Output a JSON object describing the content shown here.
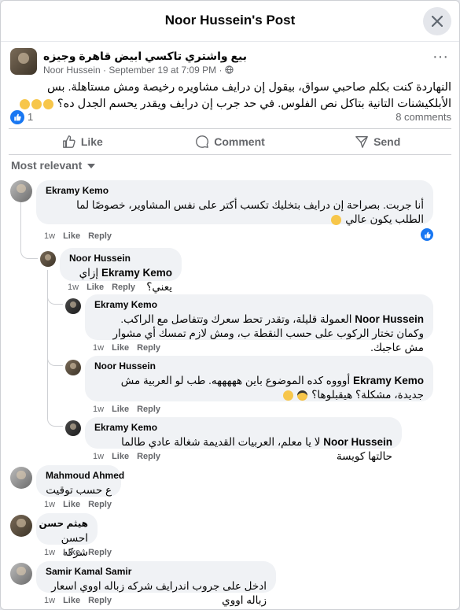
{
  "header": {
    "title": "Noor Hussein's Post"
  },
  "post": {
    "group_name": "بيع واشتري تاكسي ابيض قاهرة وجيزه",
    "author": "Noor Hussein",
    "separator": "·",
    "time": "September 19 at 7:09 PM",
    "audience_icon": "globe-icon",
    "text": "النهاردة كنت بكلم صاحبي سواق، بيقول إن درايف مشاويره رخيصة ومش مستاهلة. بس الأبلكيشنات التانية بتاكل نص الفلوس. في حد جرب إن درايف ويقدر يحسم الجدل ده؟",
    "emojis": [
      "slightly-smiling-face",
      "slightly-smiling-face",
      "slightly-smiling-face"
    ],
    "reaction_count": "1",
    "comment_count": "8 comments"
  },
  "actions": {
    "like": "Like",
    "comment": "Comment",
    "send": "Send"
  },
  "sort": {
    "label": "Most relevant"
  },
  "labels": {
    "time": "1w",
    "like": "Like",
    "reply": "Reply"
  },
  "comments": [
    {
      "name": "Ekramy Kemo",
      "text": "أنا جربت. بصراحة إن درايف بتخليك تكسب أكتر على نفس المشاوير، خصوصًا لما الطلب يكون عالي",
      "reacted": true
    },
    {
      "name": "Noor Hussein",
      "mention": "Ekramy Kemo",
      "text": "إزاي يعني؟"
    },
    {
      "name": "Ekramy Kemo",
      "mention": "Noor Hussein",
      "text": "العمولة قليلة، وتقدر تحط سعرك وتتفاصل مع الراكب. وكمان تختار الركوب على حسب النقطة ب، ومش لازم تمسك أي مشوار مش عاجبك."
    },
    {
      "name": "Noor Hussein",
      "mention": "Ekramy Kemo",
      "text": "أوووه كده الموضوع باين هههههه. طب لو العربية مش جديدة، مشكلة؟ هيقبلوها؟"
    },
    {
      "name": "Ekramy Kemo",
      "mention": "Noor Hussein",
      "text": "لا يا معلم، العربيات القديمة شغالة عادي طالما حالتها كويسة"
    },
    {
      "name": "Mahmoud Ahmed",
      "text": "ع حسب توقيت"
    },
    {
      "name": "هيثم حسن",
      "text": "احسن شركه"
    },
    {
      "name": "Samir Kamal Samir",
      "text": "ادخل على جروب اندرايف شركه زباله اووي اسعار زباله اووي"
    }
  ],
  "colors": {
    "accent": "#1877f2",
    "secondary_text": "#65676b",
    "bubble": "#f0f2f5"
  }
}
